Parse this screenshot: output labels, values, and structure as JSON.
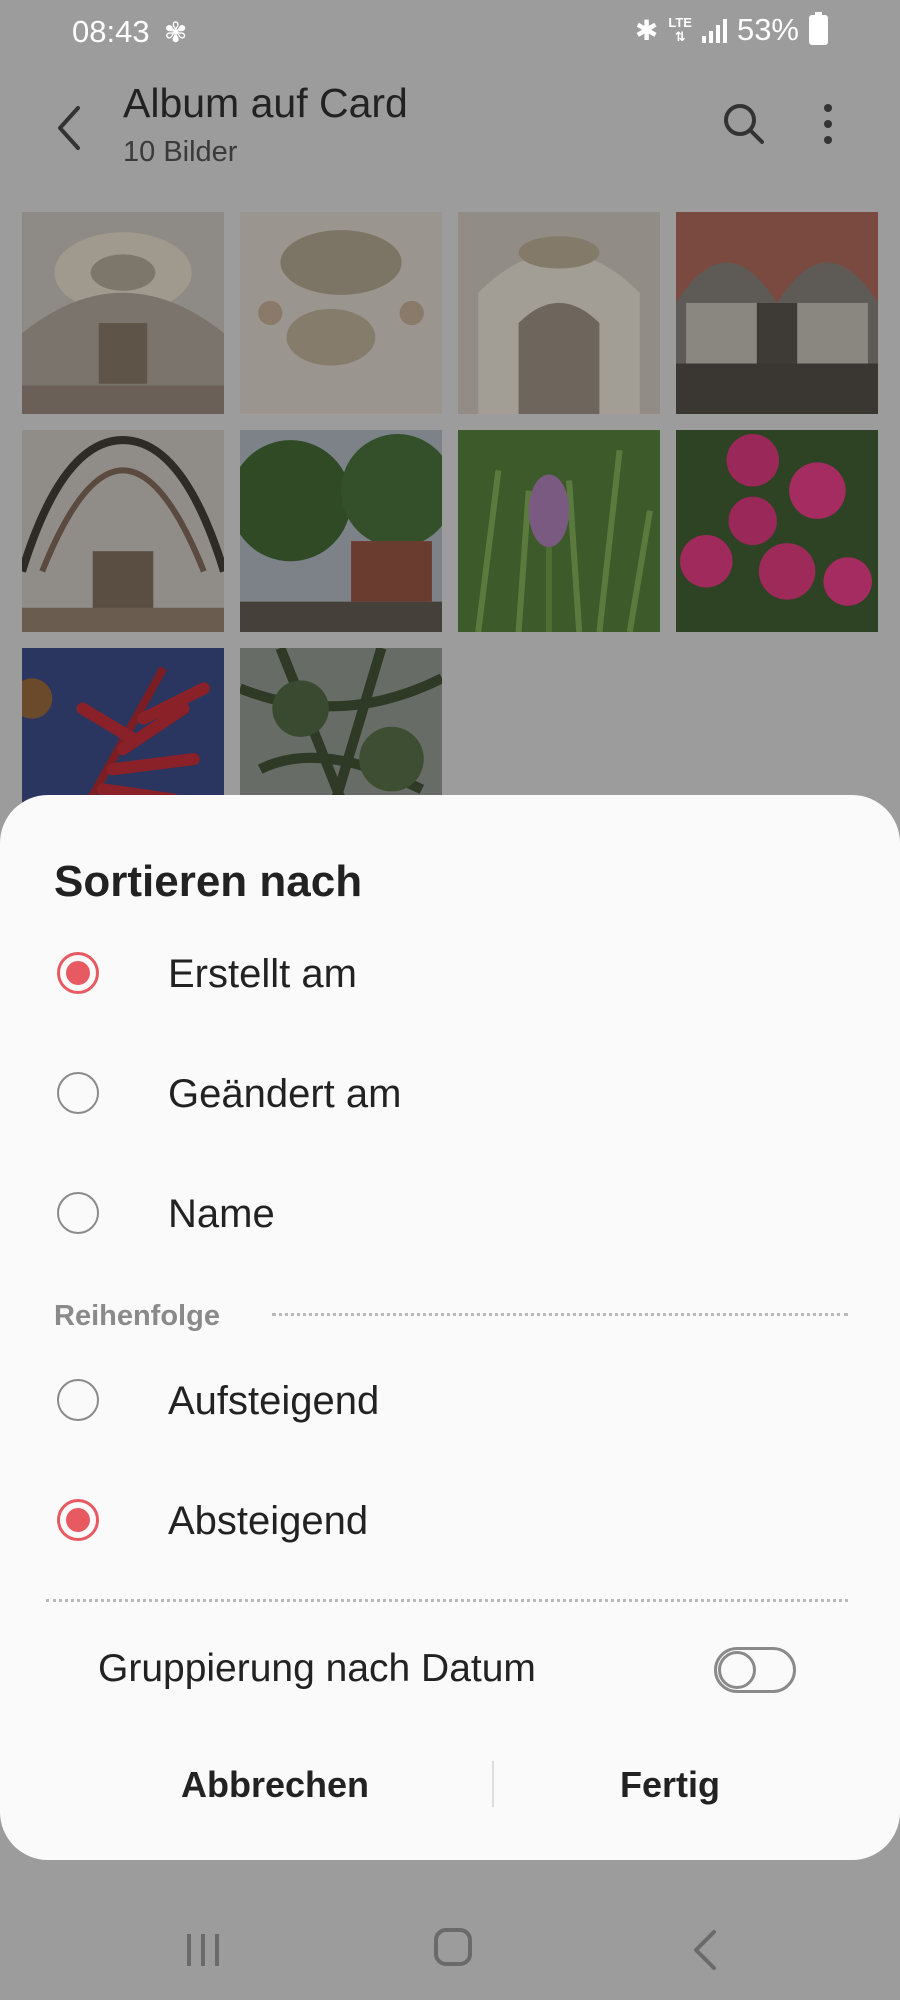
{
  "status_bar": {
    "time": "08:43",
    "battery_text": "53%"
  },
  "app_bar": {
    "title": "Album auf Card",
    "subtitle": "10 Bilder",
    "icons": [
      "back-arrow-icon",
      "search-icon",
      "more-options-icon"
    ]
  },
  "photos": {
    "count": 10,
    "items": [
      {
        "subject": "baroque church ceiling with organ"
      },
      {
        "subject": "baroque church ceiling fresco"
      },
      {
        "subject": "baroque church nave"
      },
      {
        "subject": "brick church nave"
      },
      {
        "subject": "gothic vault with organ"
      },
      {
        "subject": "trees and brick church"
      },
      {
        "subject": "purple orchid in grass"
      },
      {
        "subject": "pink dahlias"
      },
      {
        "subject": "red leaves against blue sky"
      },
      {
        "subject": "tree branches"
      }
    ]
  },
  "sort_dialog": {
    "title": "Sortieren nach",
    "sort_options": [
      {
        "label": "Erstellt am",
        "selected": true
      },
      {
        "label": "Geändert am",
        "selected": false
      },
      {
        "label": "Name",
        "selected": false
      }
    ],
    "order_section_label": "Reihenfolge",
    "order_options": [
      {
        "label": "Aufsteigend",
        "selected": false
      },
      {
        "label": "Absteigend",
        "selected": true
      }
    ],
    "group_by_date_label": "Gruppierung nach Datum",
    "group_by_date_enabled": false,
    "cancel_label": "Abbrechen",
    "done_label": "Fertig",
    "accent_color": "#e85a62"
  },
  "nav_bar": {
    "icons": [
      "recent-apps-icon",
      "home-icon",
      "back-icon"
    ]
  }
}
